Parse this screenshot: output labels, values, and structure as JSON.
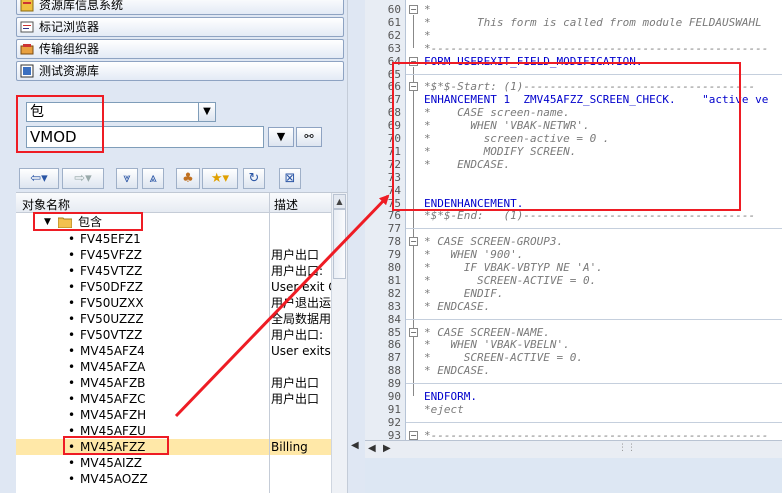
{
  "left_panel": {
    "nav_buttons": [
      {
        "label": "资源库信息系统",
        "icon": "repository-info-icon"
      },
      {
        "label": "标记浏览器",
        "icon": "tag-browser-icon"
      },
      {
        "label": "传输组织器",
        "icon": "transport-organizer-icon"
      },
      {
        "label": "测试资源库",
        "icon": "test-repository-icon"
      }
    ],
    "object_type_select": "包",
    "object_name_input": "VMOD",
    "tree": {
      "col_object": "对象名称",
      "col_desc": "描述",
      "folder_label": "包含",
      "rows": [
        {
          "name": "FV45EFZ1",
          "desc": ""
        },
        {
          "name": "FV45VFZZ",
          "desc": "用户出口"
        },
        {
          "name": "FV45VTZZ",
          "desc": "用户出口:"
        },
        {
          "name": "FV50DFZZ",
          "desc": "User exit C"
        },
        {
          "name": "FV50UZXX",
          "desc": "用户退出运"
        },
        {
          "name": "FV50UZZZ",
          "desc": "全局数据用"
        },
        {
          "name": "FV50VTZZ",
          "desc": "用户出口:"
        },
        {
          "name": "MV45AFZ4",
          "desc": "User exits"
        },
        {
          "name": "MV45AFZA",
          "desc": ""
        },
        {
          "name": "MV45AFZB",
          "desc": "用户出口"
        },
        {
          "name": "MV45AFZC",
          "desc": "用户出口"
        },
        {
          "name": "MV45AFZH",
          "desc": ""
        },
        {
          "name": "MV45AFZU",
          "desc": ""
        },
        {
          "name": "MV45AFZZ",
          "desc": "Billing"
        },
        {
          "name": "MV45AIZZ",
          "desc": ""
        },
        {
          "name": "MV45AOZZ",
          "desc": ""
        }
      ]
    }
  },
  "editor": {
    "lines": [
      {
        "n": "60",
        "t": "*",
        "c": "cm"
      },
      {
        "n": "61",
        "t": "*       This form is called from module FELDAUSWAHL",
        "c": "cm"
      },
      {
        "n": "62",
        "t": "*",
        "c": "cm"
      },
      {
        "n": "63",
        "t": "*---------------------------------------------------",
        "c": "cm"
      },
      {
        "n": "64",
        "t": "FORM USEREXIT_FIELD_MODIFICATION.",
        "c": "kw"
      },
      {
        "n": "65",
        "t": "",
        "c": "blk"
      },
      {
        "n": "66",
        "t": "*$*$-Start: (1)-----------------------------------",
        "c": "cm"
      },
      {
        "n": "67",
        "t": "ENHANCEMENT 1  ZMV45AFZZ_SCREEN_CHECK.    \"active ve",
        "c": "kw"
      },
      {
        "n": "68",
        "t": "*    CASE screen-name.",
        "c": "cm"
      },
      {
        "n": "69",
        "t": "*      WHEN 'VBAK-NETWR'.",
        "c": "cm"
      },
      {
        "n": "70",
        "t": "*        screen-active = 0 .",
        "c": "cm"
      },
      {
        "n": "71",
        "t": "*        MODIFY SCREEN.",
        "c": "cm"
      },
      {
        "n": "72",
        "t": "*    ENDCASE.",
        "c": "cm"
      },
      {
        "n": "73",
        "t": "",
        "c": "blk"
      },
      {
        "n": "74",
        "t": "",
        "c": "blk"
      },
      {
        "n": "75",
        "t": "ENDENHANCEMENT.",
        "c": "kw"
      },
      {
        "n": "76",
        "t": "*$*$-End:   (1)-----------------------------------",
        "c": "cm"
      },
      {
        "n": "77",
        "t": "",
        "c": "blk"
      },
      {
        "n": "78",
        "t": "* CASE SCREEN-GROUP3.",
        "c": "cm"
      },
      {
        "n": "79",
        "t": "*   WHEN '900'.",
        "c": "cm"
      },
      {
        "n": "80",
        "t": "*     IF VBAK-VBTYP NE 'A'.",
        "c": "cm"
      },
      {
        "n": "81",
        "t": "*       SCREEN-ACTIVE = 0.",
        "c": "cm"
      },
      {
        "n": "82",
        "t": "*     ENDIF.",
        "c": "cm"
      },
      {
        "n": "83",
        "t": "* ENDCASE.",
        "c": "cm"
      },
      {
        "n": "84",
        "t": "",
        "c": "blk"
      },
      {
        "n": "85",
        "t": "* CASE SCREEN-NAME.",
        "c": "cm"
      },
      {
        "n": "86",
        "t": "*   WHEN 'VBAK-VBELN'.",
        "c": "cm"
      },
      {
        "n": "87",
        "t": "*     SCREEN-ACTIVE = 0.",
        "c": "cm"
      },
      {
        "n": "88",
        "t": "* ENDCASE.",
        "c": "cm"
      },
      {
        "n": "89",
        "t": "",
        "c": "blk"
      },
      {
        "n": "90",
        "t": "ENDFORM.",
        "c": "kw"
      },
      {
        "n": "91",
        "t": "*eject",
        "c": "cm"
      },
      {
        "n": "92",
        "t": "",
        "c": "blk"
      },
      {
        "n": "93",
        "t": "*---------------------------------------------------",
        "c": "cm"
      },
      {
        "n": "94",
        "t": "*       FORM USEREXIT_MOVE_FIELD_TO_VBAK",
        "c": "cm"
      }
    ]
  },
  "colors": {
    "highlight": "#ee1c24",
    "keyword": "#0000cc",
    "comment": "#7a7a7a",
    "panel_bg": "#dfe7f3"
  }
}
